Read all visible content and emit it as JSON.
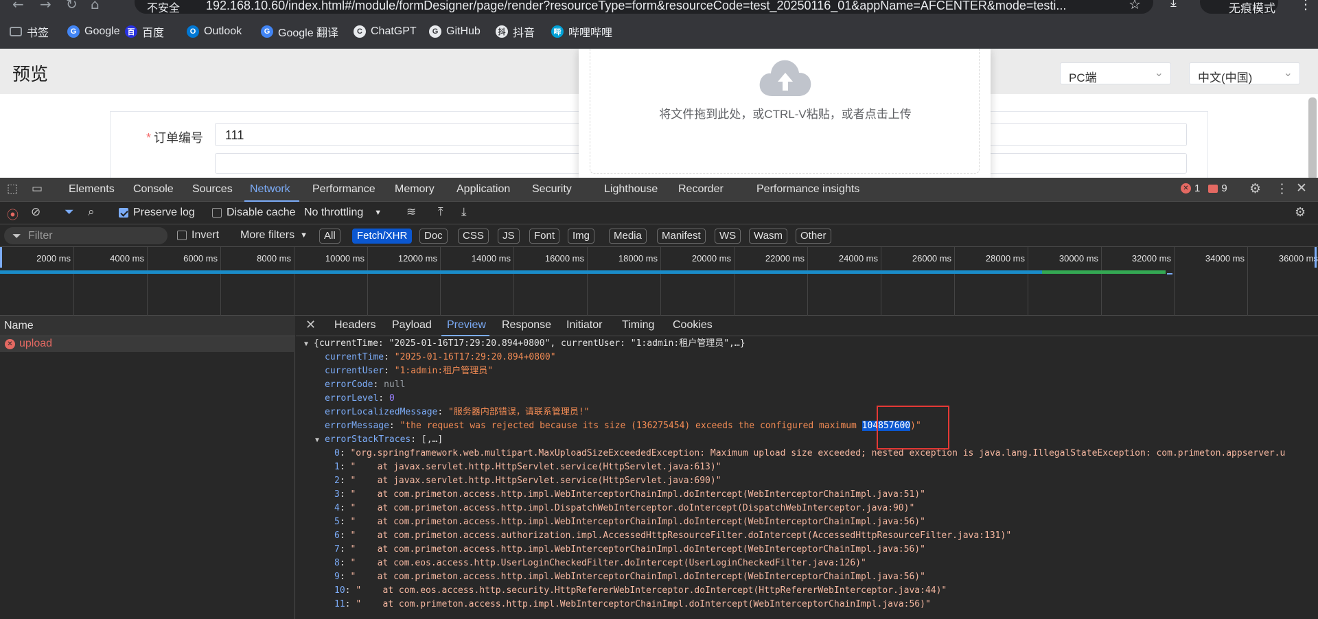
{
  "browser": {
    "security_warning": "不安全",
    "url": "192.168.10.60/index.html#/module/formDesigner/page/render?resourceType=form&resourceCode=test_20250116_01&appName=AFCENTER&mode=testi...",
    "profile_label": "无痕模式",
    "bookmarks": [
      {
        "label": "书签",
        "icon": "folder-icon",
        "color": "#9aa0a6"
      },
      {
        "label": "Google",
        "icon": "google-icon",
        "color": "#4285f4"
      },
      {
        "label": "百度",
        "icon": "baidu-icon",
        "color": "#2932e1"
      },
      {
        "label": "Outlook",
        "icon": "outlook-icon",
        "color": "#0078d4"
      },
      {
        "label": "Google 翻译",
        "icon": "translate-icon",
        "color": "#4285f4"
      },
      {
        "label": "ChatGPT",
        "icon": "chatgpt-icon",
        "color": "#e8eaed"
      },
      {
        "label": "GitHub",
        "icon": "github-icon",
        "color": "#e8eaed"
      },
      {
        "label": "抖音",
        "icon": "douyin-icon",
        "color": "#e8eaed"
      },
      {
        "label": "哔哩哔哩",
        "icon": "bilibili-icon",
        "color": "#00a1d6"
      }
    ]
  },
  "page": {
    "title": "预览",
    "device_select": "PC端",
    "language_select": "中文(中国)",
    "form": {
      "order_label": "订单编号",
      "order_value": "111"
    },
    "upload_text": "将文件拖到此处，或CTRL-V粘贴，或者点击上传"
  },
  "devtools": {
    "tabs": [
      "Elements",
      "Console",
      "Sources",
      "Network",
      "Performance",
      "Memory",
      "Application",
      "Security",
      "Lighthouse",
      "Recorder",
      "Performance insights"
    ],
    "active_tab": "Network",
    "error_count": "1",
    "issue_count": "9",
    "preserve_log": "Preserve log",
    "disable_cache": "Disable cache",
    "throttling": "No throttling",
    "filter_placeholder": "Filter",
    "invert": "Invert",
    "more_filters": "More filters",
    "type_filters": [
      "All",
      "Fetch/XHR",
      "Doc",
      "CSS",
      "JS",
      "Font",
      "Img",
      "Media",
      "Manifest",
      "WS",
      "Wasm",
      "Other"
    ],
    "active_type_filter": "Fetch/XHR",
    "timeline_ticks": [
      "2000 ms",
      "4000 ms",
      "6000 ms",
      "8000 ms",
      "10000 ms",
      "12000 ms",
      "14000 ms",
      "16000 ms",
      "18000 ms",
      "20000 ms",
      "22000 ms",
      "24000 ms",
      "26000 ms",
      "28000 ms",
      "30000 ms",
      "32000 ms",
      "34000 ms",
      "36000 ms"
    ],
    "name_header": "Name",
    "request_name": "upload",
    "detail_tabs": [
      "Headers",
      "Payload",
      "Preview",
      "Response",
      "Initiator",
      "Timing",
      "Cookies"
    ],
    "active_detail_tab": "Preview",
    "preview": {
      "summary": "{currentTime: \"2025-01-16T17:29:20.894+0800\", currentUser: \"1:admin:租户管理员\",…}",
      "currentTime_key": "currentTime",
      "currentTime_val": "\"2025-01-16T17:29:20.894+0800\"",
      "currentUser_key": "currentUser",
      "currentUser_val": "\"1:admin:租户管理员\"",
      "errorCode_key": "errorCode",
      "errorCode_val": "null",
      "errorLevel_key": "errorLevel",
      "errorLevel_val": "0",
      "errorLocalizedMessage_key": "errorLocalizedMessage",
      "errorLocalizedMessage_val": "\"服务器内部错误，请联系管理员!\"",
      "errorMessage_key": "errorMessage",
      "errorMessage_val_pre": "\"the request was rejected because its size (136275454) exceeds the configured maximum ",
      "errorMessage_val_hl": "104857600",
      "errorMessage_val_post": ")\"",
      "errorStackTraces_key": "errorStackTraces",
      "errorStackTraces_val": "[,…]",
      "traces": [
        {
          "i": "0",
          "v": "\"org.springframework.web.multipart.MaxUploadSizeExceededException: Maximum upload size exceeded; nested exception is java.lang.IllegalStateException: com.primeton.appserver.u"
        },
        {
          "i": "1",
          "v": "\"    at javax.servlet.http.HttpServlet.service(HttpServlet.java:613)\""
        },
        {
          "i": "2",
          "v": "\"    at javax.servlet.http.HttpServlet.service(HttpServlet.java:690)\""
        },
        {
          "i": "3",
          "v": "\"    at com.primeton.access.http.impl.WebInterceptorChainImpl.doIntercept(WebInterceptorChainImpl.java:51)\""
        },
        {
          "i": "4",
          "v": "\"    at com.primeton.access.http.impl.DispatchWebInterceptor.doIntercept(DispatchWebInterceptor.java:90)\""
        },
        {
          "i": "5",
          "v": "\"    at com.primeton.access.http.impl.WebInterceptorChainImpl.doIntercept(WebInterceptorChainImpl.java:56)\""
        },
        {
          "i": "6",
          "v": "\"    at com.primeton.access.authorization.impl.AccessedHttpResourceFilter.doIntercept(AccessedHttpResourceFilter.java:131)\""
        },
        {
          "i": "7",
          "v": "\"    at com.primeton.access.http.impl.WebInterceptorChainImpl.doIntercept(WebInterceptorChainImpl.java:56)\""
        },
        {
          "i": "8",
          "v": "\"    at com.eos.access.http.UserLoginCheckedFilter.doIntercept(UserLoginCheckedFilter.java:126)\""
        },
        {
          "i": "9",
          "v": "\"    at com.primeton.access.http.impl.WebInterceptorChainImpl.doIntercept(WebInterceptorChainImpl.java:56)\""
        },
        {
          "i": "10",
          "v": "\"    at com.eos.access.http.security.HttpRefererWebInterceptor.doIntercept(HttpRefererWebInterceptor.java:44)\""
        },
        {
          "i": "11",
          "v": "\"    at com.primeton.access.http.impl.WebInterceptorChainImpl.doIntercept(WebInterceptorChainImpl.java:56)\""
        }
      ]
    }
  }
}
